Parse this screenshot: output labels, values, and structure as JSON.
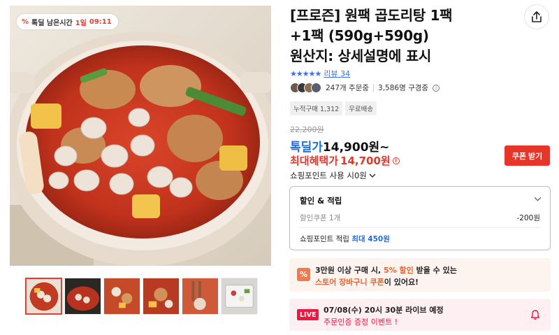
{
  "timer_badge": {
    "icon": "percent-icon",
    "label": "톡딜 남은시간",
    "days": "1일",
    "time": "09:11"
  },
  "product": {
    "title_line1": "[프로즌] 원팩 곱도리탕 1팩",
    "title_line2": "+1팩 (590g+590g)",
    "title_line3": "원산지: 상세설명에 표시"
  },
  "rating": {
    "stars": "★★★★★",
    "score": 5,
    "review_label": "리뷰",
    "review_count": "34"
  },
  "orders": {
    "order_count": "247개 주문중",
    "subscribers": "3,586명 구경중"
  },
  "tags": [
    "누적구매 1,312",
    "무료배송"
  ],
  "price": {
    "original": "22,200원",
    "sale_label": "톡딜가",
    "sale_price": "14,900원~",
    "benefit_label": "최대혜택가",
    "benefit_price": "14,700원",
    "coupon_button": "쿠폰 받기",
    "point_use": "쇼핑포인트 사용 시0원"
  },
  "discount_box": {
    "header": "할인 & 적립",
    "coupon_label": "할인쿠폰 1개",
    "coupon_value": "-200원",
    "point_label": "쇼핑포인트 적립",
    "point_max": "최대 450원"
  },
  "cart_coupon": {
    "icon": "%",
    "line1_a": "3만원 이상 구매 시, ",
    "line1_b": "5% 할인",
    "line1_c": " 받을 수 있는",
    "line2_a": "스토어 장바구니 쿠폰",
    "line2_b": "이 있어요!"
  },
  "live": {
    "badge": "LIVE",
    "schedule": "07/08(수) 20시 30분 라이브 예정",
    "event": "주문인증 증정 이벤트 !"
  },
  "colors": {
    "accent_red": "#e8352a",
    "accent_blue": "#1f6ee6",
    "live_pink": "#f0163e"
  }
}
